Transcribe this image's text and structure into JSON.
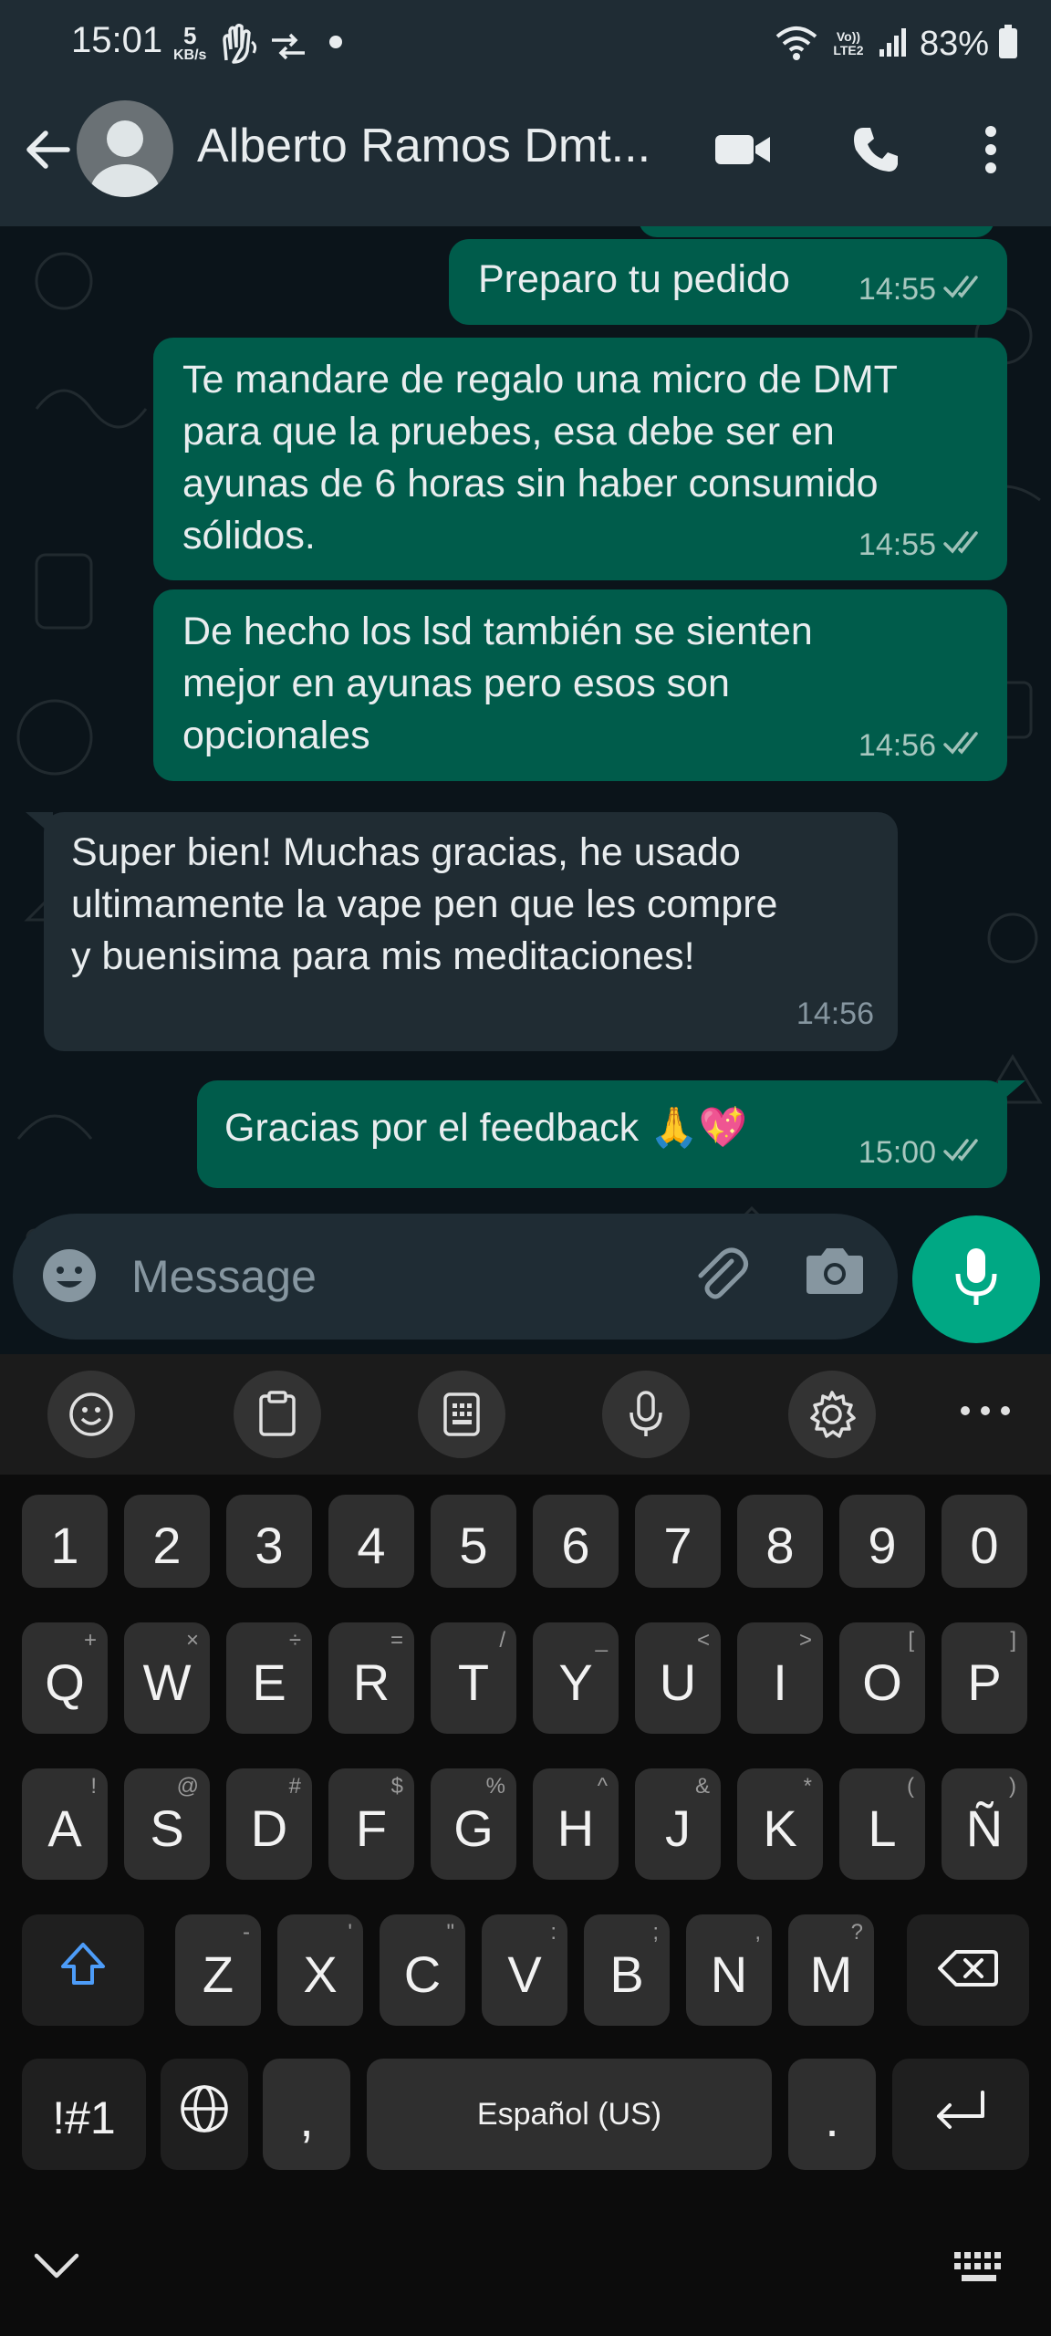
{
  "status_bar": {
    "time": "15:01",
    "net_speed_value": "5",
    "net_speed_unit": "KB/s",
    "volte_label": "Vo)) LTE2",
    "battery": "83%"
  },
  "header": {
    "contact_name": "Alberto Ramos Dmt...",
    "icons": [
      "back-arrow-icon",
      "avatar",
      "video-call-icon",
      "phone-icon",
      "more-icon"
    ]
  },
  "messages": [
    {
      "direction": "out",
      "text": "Preparo tu pedido",
      "time": "14:55",
      "status": "read"
    },
    {
      "direction": "out",
      "lines": [
        "Te mandare de regalo una micro de DMT",
        "para que la pruebes, esa debe ser en",
        "ayunas de 6 horas sin haber consumido",
        "sólidos."
      ],
      "time": "14:55",
      "status": "read"
    },
    {
      "direction": "out",
      "lines": [
        "De hecho los lsd también se sienten",
        "mejor en ayunas pero esos son",
        "opcionales"
      ],
      "time": "14:56",
      "status": "read"
    },
    {
      "direction": "in",
      "lines": [
        "Super bien! Muchas gracias, he usado",
        "ultimamente la vape pen que les compre",
        "y buenisima para mis meditaciones!"
      ],
      "time": "14:56"
    },
    {
      "direction": "out",
      "text": "Gracias por el feedback 🙏💖",
      "time": "15:00",
      "status": "read"
    }
  ],
  "composer": {
    "placeholder": "Message",
    "value": ""
  },
  "keyboard": {
    "toolbar": [
      "emoji-icon",
      "clipboard-icon",
      "keypad-icon",
      "voice-input-icon",
      "settings-icon",
      "more-icon"
    ],
    "number_row": [
      "1",
      "2",
      "3",
      "4",
      "5",
      "6",
      "7",
      "8",
      "9",
      "0"
    ],
    "row1": [
      [
        "Q",
        "+"
      ],
      [
        "W",
        "×"
      ],
      [
        "E",
        "÷"
      ],
      [
        "R",
        "="
      ],
      [
        "T",
        "/"
      ],
      [
        "Y",
        "_"
      ],
      [
        "U",
        "<"
      ],
      [
        "I",
        ">"
      ],
      [
        "O",
        "["
      ],
      [
        "P",
        "]"
      ]
    ],
    "row2": [
      [
        "A",
        "!"
      ],
      [
        "S",
        "@"
      ],
      [
        "D",
        "#"
      ],
      [
        "F",
        "$"
      ],
      [
        "G",
        "%"
      ],
      [
        "H",
        "^"
      ],
      [
        "J",
        "&"
      ],
      [
        "K",
        "*"
      ],
      [
        "L",
        "("
      ],
      [
        "Ñ",
        ")"
      ]
    ],
    "row3": [
      [
        "Z",
        "-"
      ],
      [
        "X",
        "'"
      ],
      [
        "C",
        "\""
      ],
      [
        "V",
        ":"
      ],
      [
        "B",
        ";"
      ],
      [
        "N",
        ","
      ],
      [
        "M",
        "?"
      ]
    ],
    "symbols_key": "!#1",
    "comma_key": ",",
    "space_label": "Español (US)",
    "period_key": "."
  },
  "colors": {
    "outgoing_bubble": "#005c4b",
    "incoming_bubble": "#202c33",
    "accent": "#00a884",
    "read_ticks": "#9fc1b8",
    "background": "#0b141a"
  }
}
